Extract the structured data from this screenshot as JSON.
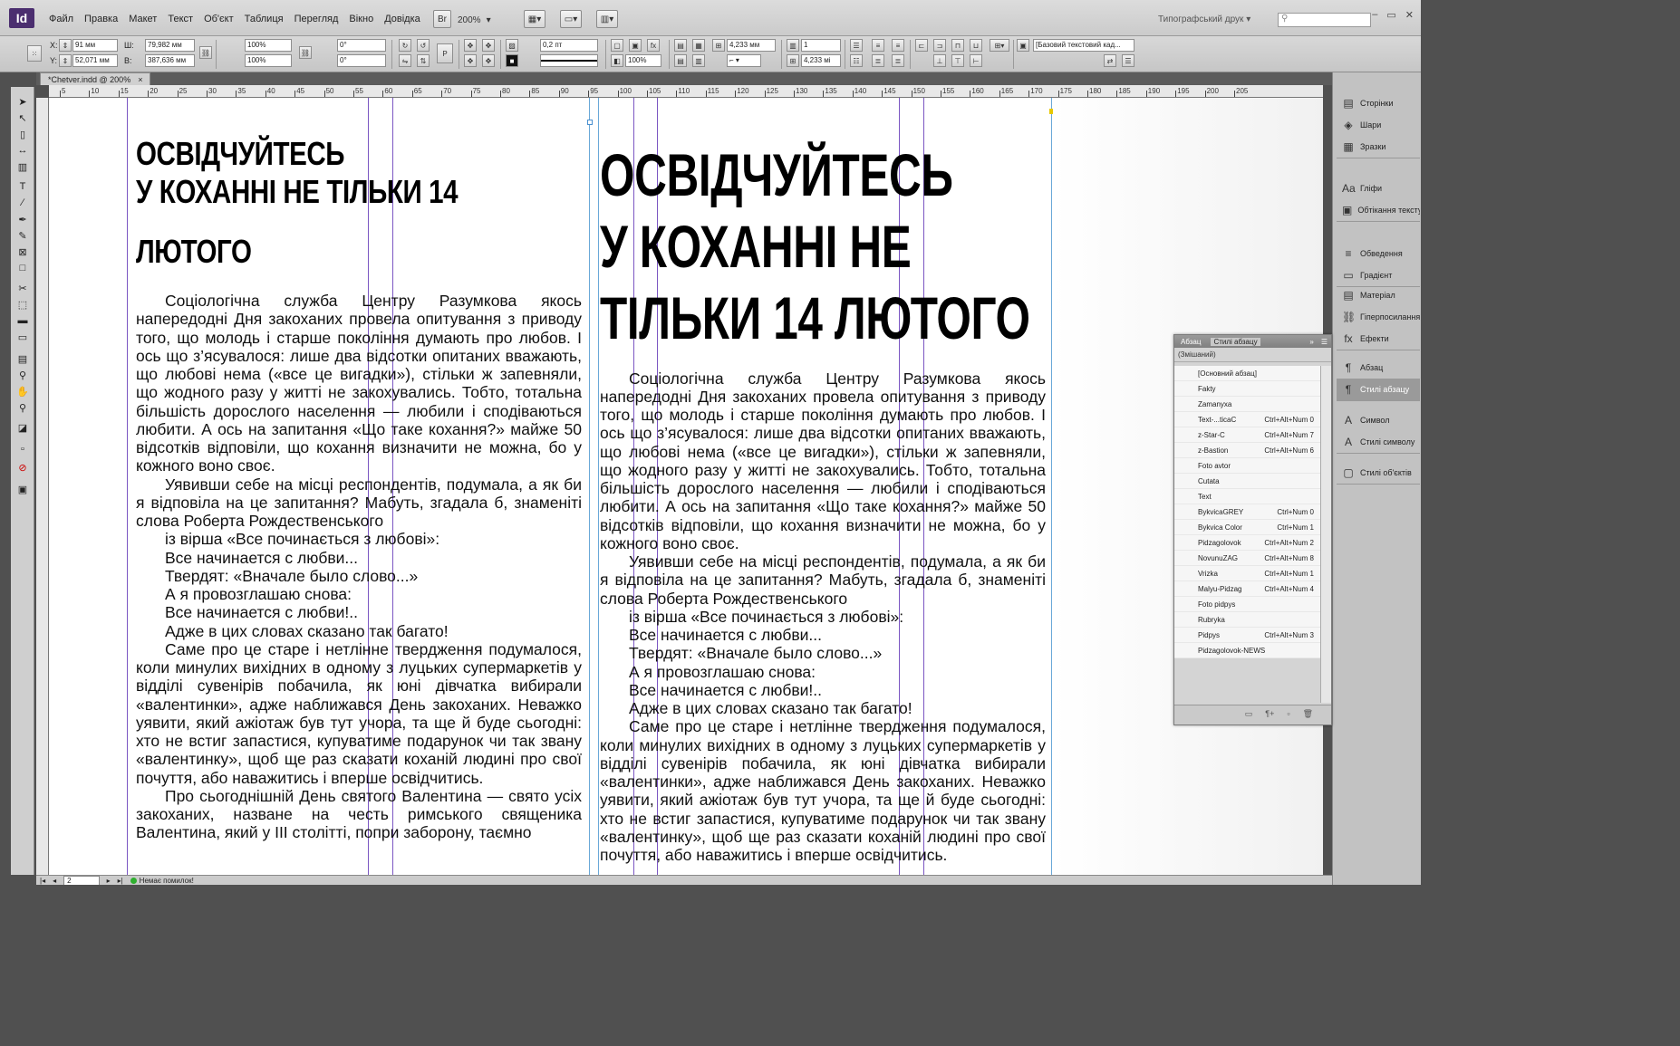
{
  "app": {
    "logo": "Id"
  },
  "menu": [
    "Файл",
    "Правка",
    "Макет",
    "Текст",
    "Об'єкт",
    "Таблиця",
    "Перегляд",
    "Вікно",
    "Довідка"
  ],
  "zoom": "200%",
  "workspace": "Типографський друк",
  "control": {
    "x": "91 мм",
    "y": "52,071 мм",
    "w": "79,982 мм",
    "h": "387,636 мм",
    "scale_x": "100%",
    "scale_y": "100%",
    "rotate": "0°",
    "shear": "0°",
    "stroke_weight": "0,2 пт",
    "gutter": "4,233 мм",
    "columns": "1",
    "col_width": "4,233 мі",
    "opacity": "100%",
    "frame_style": "[Базовий текстовий кад..."
  },
  "doc_tab": {
    "label": "*Chetver.indd @ 200%",
    "close": "×"
  },
  "ruler_h": [
    "5",
    "10",
    "15",
    "20",
    "25",
    "30",
    "35",
    "40",
    "45",
    "50",
    "55",
    "60",
    "65",
    "70",
    "75",
    "80",
    "85",
    "90",
    "95",
    "100",
    "105",
    "110",
    "115",
    "120",
    "125",
    "130",
    "135",
    "140",
    "145",
    "150",
    "155",
    "160",
    "165",
    "170",
    "175",
    "180",
    "185",
    "190",
    "195",
    "200",
    "205"
  ],
  "article": {
    "headline_small": [
      "ОСВІДЧУЙТЕСЬ",
      "У КОХАННІ НЕ ТІЛЬКИ 14",
      "",
      "ЛЮТОГО"
    ],
    "headline_large": [
      "ОСВІДЧУЙТЕСЬ",
      "У КОХАННІ НЕ",
      "ТІЛЬКИ 14 ЛЮТОГО"
    ],
    "p1": "Соціологічна служба Центру Разумкова якось напередодні Дня закоханих провела опитування з приводу того, що молодь і старше покоління думають про любов. І ось що з’ясувалося: лише два відсотки опитаних вважають, що любові нема («все це вигадки»), стільки ж запевняли, що жодного разу у житті не закохувались. Тобто, тотальна більшість дорослого населення — люби­ли і сподіваються любити. А ось на запитання «Що таке кохання?» майже 50 відсотків відповіли, що кохання визначити не можна, бо у кожного воно своє.",
    "p2": "Уявивши себе на місці респондентів, подумала, а як би я відповіла на це запитання? Мабуть, згадала б, знаменіті слова Роберта Рождественського",
    "poem": [
      "із вірша «Все починається з любові»:",
      "Все начинается с любви...",
      "Твердят: «Вначале было слово...»",
      "А я провозглашаю снова:",
      "Все начинается с любви!..",
      "Адже в цих словах сказано так багато!"
    ],
    "p3": "Саме про це старе і нетлінне твердження подумалося, коли минулих вихідних в одному з луцьких супермаркетів у відділі сувенірів побачила, як юні дівчатка вибирали «валентинки», адже наближався День закоханих. Неважко уявити, який ажіотаж був тут учора, та ще й буде сьогодні: хто не встиг запастися, купуватиме подарунок чи так звану «валентинку», щоб ще раз сказати коханій людині про свої почуття, або наважитись і вперше освідчитись.",
    "p4": "Про сьогоднішній День святого Валентина — свято усіх закоханих, назване на честь римського священика Валентина, який у ІІІ столітті, попри заборону, таємно"
  },
  "dock": [
    {
      "label": "Сторінки",
      "icon": "▤"
    },
    {
      "label": "Шари",
      "icon": "◈"
    },
    {
      "label": "Зразки",
      "icon": "▦"
    },
    {
      "label": "Гліфи",
      "icon": "Aa"
    },
    {
      "label": "Обтікання тексту",
      "icon": "▣"
    },
    {
      "label": "Обведення",
      "icon": "≡"
    },
    {
      "label": "Градієнт",
      "icon": "▭"
    },
    {
      "label": "Матеріал",
      "icon": "▤"
    },
    {
      "label": "Гіперпосилання",
      "icon": "⛓"
    },
    {
      "label": "Ефекти",
      "icon": "fx"
    },
    {
      "label": "Абзац",
      "icon": "¶"
    },
    {
      "label": "Стилі абзацу",
      "icon": "¶"
    },
    {
      "label": "Символ",
      "icon": "A"
    },
    {
      "label": "Стилі символу",
      "icon": "A"
    },
    {
      "label": "Стилі об'єктів",
      "icon": "▢"
    }
  ],
  "style_panel": {
    "tab_para": "Абзац",
    "tab_styles": "Стилі абзацу",
    "current": "(Змішаний)",
    "styles": [
      {
        "name": "[Основний абзац]",
        "key": ""
      },
      {
        "name": "Fakty",
        "key": ""
      },
      {
        "name": "Zamanyxa",
        "key": ""
      },
      {
        "name": "Text-...ticaC",
        "key": "Ctrl+Alt+Num 0"
      },
      {
        "name": "z-Star-C",
        "key": "Ctrl+Alt+Num 7"
      },
      {
        "name": "z-Bastion",
        "key": "Ctrl+Alt+Num 6"
      },
      {
        "name": "Foto avtor",
        "key": ""
      },
      {
        "name": "Cutata",
        "key": ""
      },
      {
        "name": "Text",
        "key": ""
      },
      {
        "name": "BykvicaGREY",
        "key": "Ctrl+Num 0"
      },
      {
        "name": "Bykvica Color",
        "key": "Ctrl+Num 1"
      },
      {
        "name": "Pidzagolovok",
        "key": "Ctrl+Alt+Num 2"
      },
      {
        "name": "NovunuZAG",
        "key": "Ctrl+Alt+Num 8"
      },
      {
        "name": "Vrizka",
        "key": "Ctrl+Alt+Num 1"
      },
      {
        "name": "Malyu-Pidzag",
        "key": "Ctrl+Alt+Num 4"
      },
      {
        "name": "Foto pidpys",
        "key": ""
      },
      {
        "name": "Rubryka",
        "key": ""
      },
      {
        "name": "Pidpys",
        "key": "Ctrl+Alt+Num 3"
      },
      {
        "name": "Pidzagolovok-NEWS",
        "key": ""
      }
    ]
  },
  "status": {
    "page": "2",
    "preflight": "Немає помилок!"
  }
}
